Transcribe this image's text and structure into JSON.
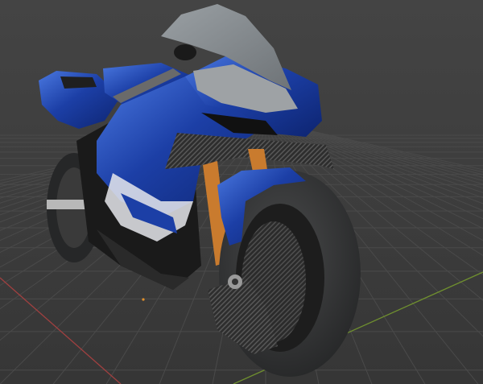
{
  "viewport": {
    "background_color": "#3d3d3d",
    "grid_color": "#4a4a4a",
    "x_axis_color": "#a04040",
    "y_axis_color": "#6f8f2f",
    "origin_marker_color": "#e0902c"
  },
  "model": {
    "body_color": "#1c3fa6",
    "body_highlight_color": "#4a78e0",
    "windscreen_color": "#8d9296",
    "carbon_color": "#3a3a3a",
    "tire_color": "#2e2f30",
    "fork_color": "#c97b2e",
    "frame_color": "#1a1a1a"
  }
}
